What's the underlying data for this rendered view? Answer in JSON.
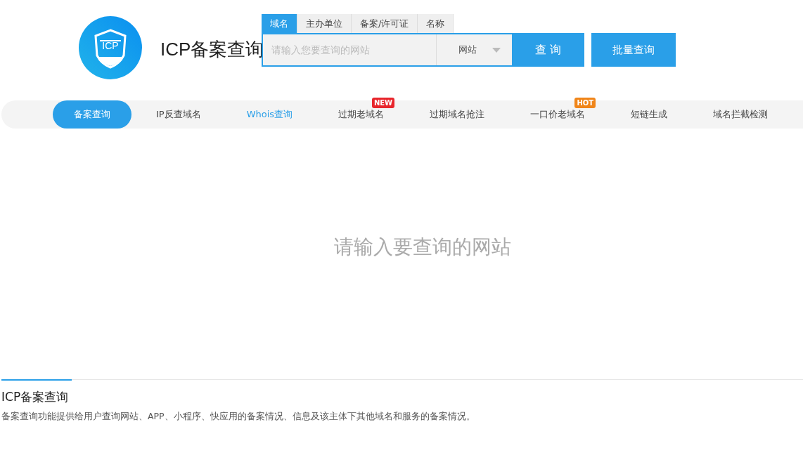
{
  "header": {
    "logo_text": "ICP",
    "title": "ICP备案查询"
  },
  "search": {
    "tabs": [
      {
        "label": "域名",
        "selected": true
      },
      {
        "label": "主办单位",
        "selected": false
      },
      {
        "label": "备案/许可证",
        "selected": false
      },
      {
        "label": "名称",
        "selected": false
      }
    ],
    "placeholder": "请输入您要查询的网站",
    "type_select": "网站",
    "submit": "查 询",
    "batch": "批量查询"
  },
  "nav": [
    {
      "label": "备案查询",
      "selected": true,
      "highlighted": false
    },
    {
      "label": "IP反查域名",
      "selected": false,
      "highlighted": false
    },
    {
      "label": "Whois查询",
      "selected": false,
      "highlighted": true
    },
    {
      "label": "过期老域名",
      "selected": false,
      "highlighted": false,
      "badge": {
        "text": "NEW",
        "color": "#e8262c"
      }
    },
    {
      "label": "过期域名抢注",
      "selected": false,
      "highlighted": false
    },
    {
      "label": "一口价老域名",
      "selected": false,
      "highlighted": false,
      "badge": {
        "text": "HOT",
        "color": "#f08519"
      }
    },
    {
      "label": "短链生成",
      "selected": false,
      "highlighted": false
    },
    {
      "label": "域名拦截检测",
      "selected": false,
      "highlighted": false
    }
  ],
  "empty_message": "请输入要查询的网站",
  "footer": {
    "title": "ICP备案查询",
    "description": "备案查询功能提供给用户查询网站、APP、小程序、快应用的备案情况、信息及该主体下其他域名和服务的备案情况。"
  }
}
